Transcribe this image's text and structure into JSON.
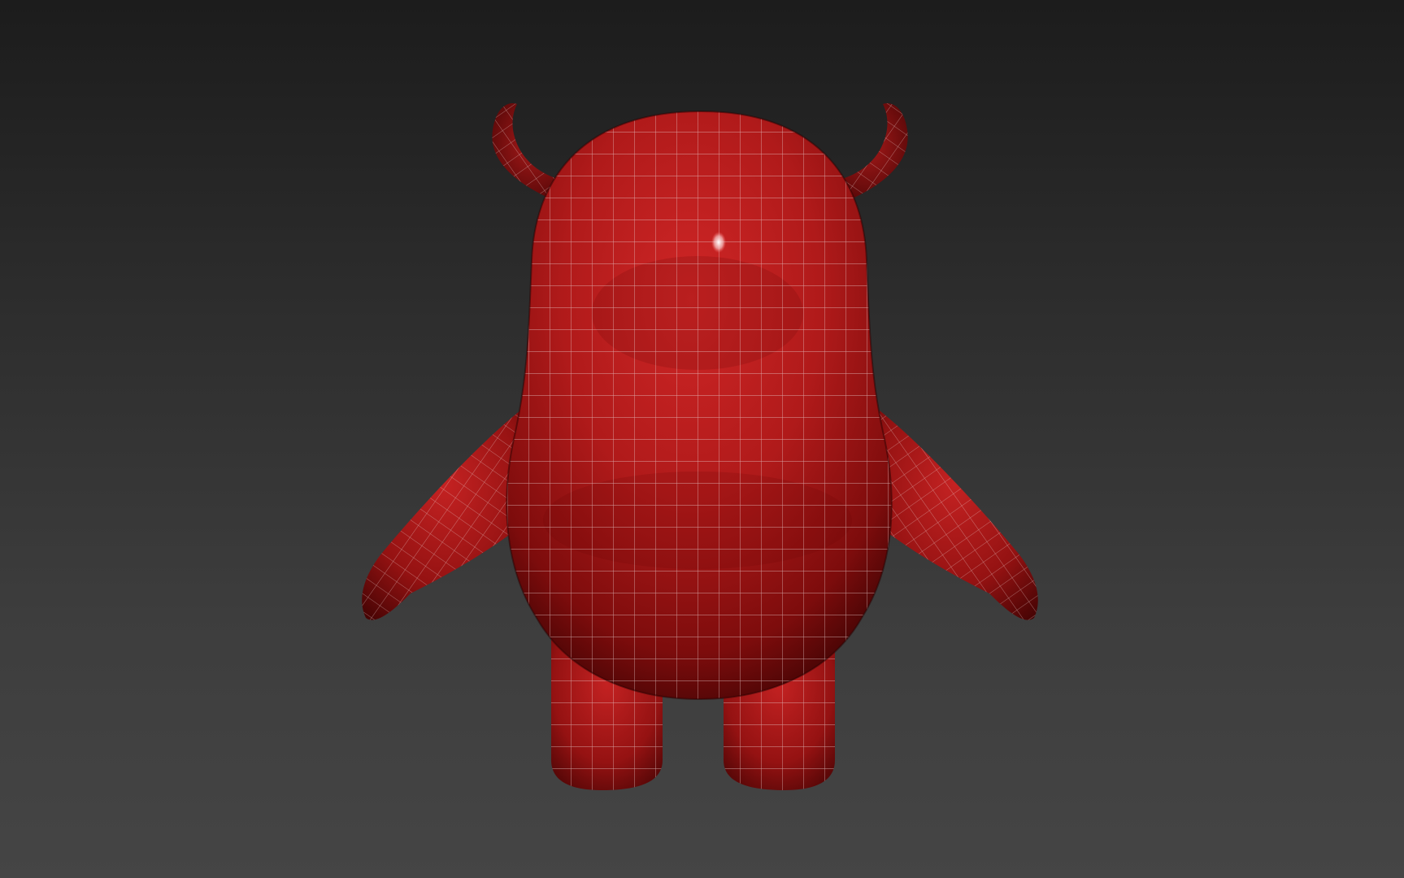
{
  "viewport": {
    "background_top": "#1c1c1c",
    "background_bottom": "#454545"
  },
  "model": {
    "subject": "devil-character-mesh",
    "shading": "smooth-with-wireframe",
    "colors": {
      "body": "#b51c1c",
      "body_dark": "#5a0606",
      "body_light": "#d83030",
      "wire": "#e8d6d6",
      "specular": "#ffffff"
    }
  }
}
